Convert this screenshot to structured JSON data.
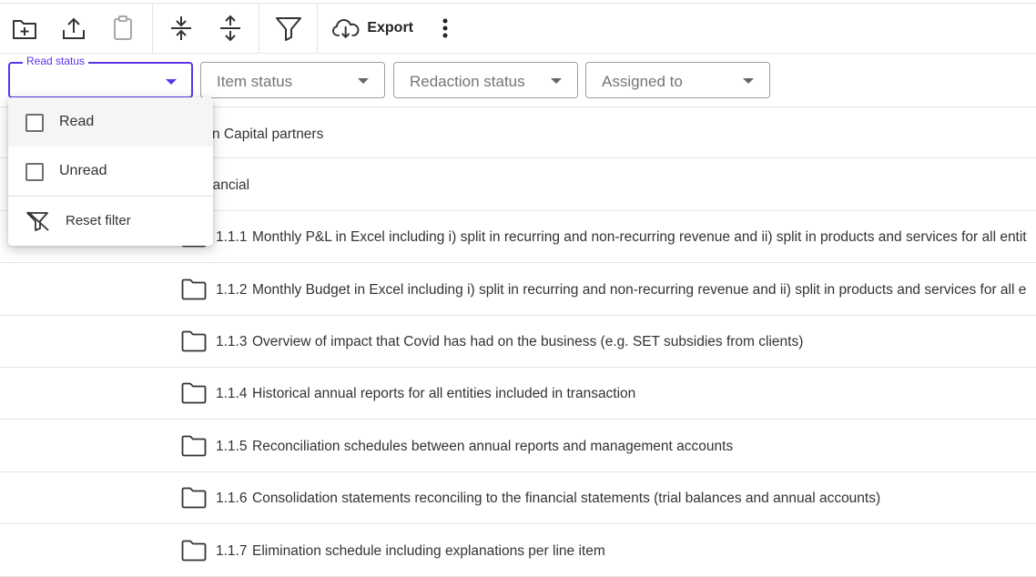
{
  "toolbar": {
    "export_label": "Export",
    "icons": [
      "new-folder-icon",
      "upload-icon",
      "clipboard-icon",
      "collapse-icon",
      "expand-icon",
      "filter-icon",
      "cloud-download-icon",
      "more-vert-icon"
    ]
  },
  "filters": {
    "read_status": {
      "label": "Read status",
      "value": ""
    },
    "item_status": {
      "placeholder": "Item status"
    },
    "redaction_status": {
      "placeholder": "Redaction status"
    },
    "assigned_to": {
      "placeholder": "Assigned to"
    }
  },
  "menu": {
    "options": [
      {
        "label": "Read",
        "checked": false
      },
      {
        "label": "Unread",
        "checked": false
      }
    ],
    "reset_label": "Reset filter"
  },
  "rows": {
    "r0": {
      "title": "n Capital partners"
    },
    "r1": {
      "title": "nancial"
    },
    "r2": {
      "num": "1.1.1",
      "title": "Monthly P&L in Excel including i) split in recurring and non-recurring revenue and ii) split in products and services for all entit"
    },
    "r3": {
      "num": "1.1.2",
      "title": "Monthly Budget in Excel including i) split in recurring and non-recurring revenue and ii) split in products and services for all e"
    },
    "r4": {
      "num": "1.1.3",
      "title": "Overview of impact that Covid has had on the business (e.g. SET subsidies from clients)"
    },
    "r5": {
      "num": "1.1.4",
      "title": "Historical annual reports for all entities included in transaction"
    },
    "r6": {
      "num": "1.1.5",
      "title": "Reconciliation schedules between annual reports and management accounts"
    },
    "r7": {
      "num": "1.1.6",
      "title": "Consolidation statements reconciling to the financial statements (trial balances and annual accounts)"
    },
    "r8": {
      "num": "1.1.7",
      "title": "Elimination schedule including explanations per line item"
    }
  },
  "colors": {
    "accent": "#5b34e8",
    "border": "#9e9e9e",
    "text": "#333333"
  }
}
